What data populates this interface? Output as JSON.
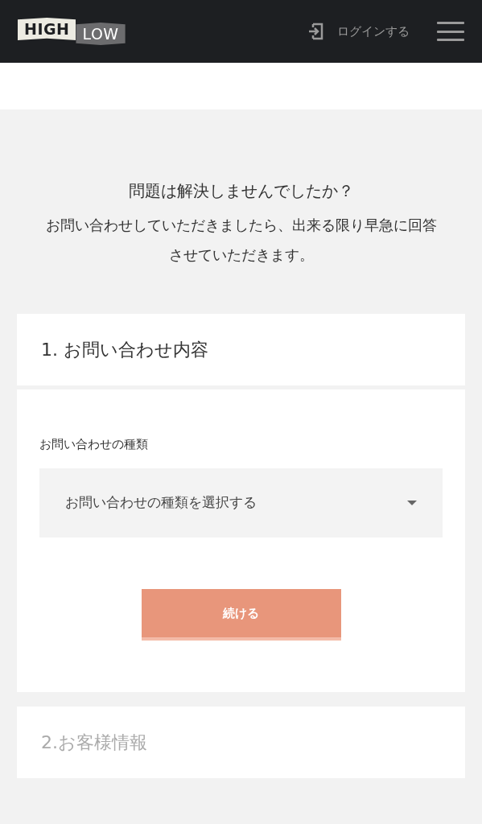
{
  "header": {
    "logo": [
      "HIGH",
      "LOW"
    ],
    "login": "ログインする"
  },
  "intro": {
    "title": "問題は解決しませんでしたか？",
    "text": "お問い合わせしていただきましたら、出来る限り早急に回答させていただきます。"
  },
  "steps": [
    {
      "title": "1. お問い合わせ内容",
      "active": true,
      "field_label": "お問い合わせの種類",
      "select_placeholder": "お問い合わせの種類を選択する",
      "button": {
        "label": "続ける",
        "disabled": true
      }
    },
    {
      "title": "2.お客様情報",
      "active": false
    }
  ]
}
